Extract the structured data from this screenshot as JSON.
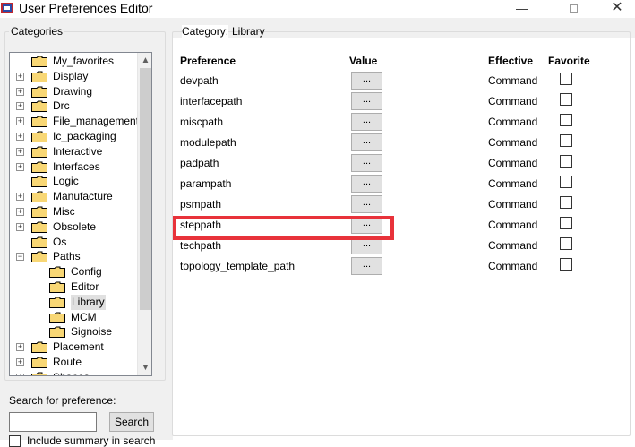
{
  "window": {
    "title": "User Preferences Editor",
    "minimize_glyph": "—",
    "close_glyph": "✕"
  },
  "categories_panel": {
    "label": "Categories",
    "tree": [
      {
        "label": "My_favorites",
        "expander": "",
        "level": 0
      },
      {
        "label": "Display",
        "expander": "+",
        "level": 0
      },
      {
        "label": "Drawing",
        "expander": "+",
        "level": 0
      },
      {
        "label": "Drc",
        "expander": "+",
        "level": 0
      },
      {
        "label": "File_management",
        "expander": "+",
        "level": 0
      },
      {
        "label": "Ic_packaging",
        "expander": "+",
        "level": 0
      },
      {
        "label": "Interactive",
        "expander": "+",
        "level": 0
      },
      {
        "label": "Interfaces",
        "expander": "+",
        "level": 0
      },
      {
        "label": "Logic",
        "expander": "",
        "level": 0
      },
      {
        "label": "Manufacture",
        "expander": "+",
        "level": 0
      },
      {
        "label": "Misc",
        "expander": "+",
        "level": 0
      },
      {
        "label": "Obsolete",
        "expander": "+",
        "level": 0
      },
      {
        "label": "Os",
        "expander": "",
        "level": 0
      },
      {
        "label": "Paths",
        "expander": "−",
        "level": 0
      },
      {
        "label": "Config",
        "expander": "",
        "level": 1
      },
      {
        "label": "Editor",
        "expander": "",
        "level": 1
      },
      {
        "label": "Library",
        "expander": "",
        "level": 1,
        "selected": true
      },
      {
        "label": "MCM",
        "expander": "",
        "level": 1
      },
      {
        "label": "Signoise",
        "expander": "",
        "level": 1
      },
      {
        "label": "Placement",
        "expander": "+",
        "level": 0
      },
      {
        "label": "Route",
        "expander": "+",
        "level": 0
      },
      {
        "label": "Shapes",
        "expander": "+",
        "level": 0
      }
    ],
    "scroll_up_glyph": "▲",
    "scroll_down_glyph": "▼",
    "search_label": "Search for preference:",
    "search_value": "",
    "search_button": "Search",
    "include_summary_label": "Include summary in search"
  },
  "category_panel": {
    "prefix": "Category:",
    "name": "Library",
    "headers": {
      "preference": "Preference",
      "value": "Value",
      "effective": "Effective",
      "favorite": "Favorite"
    },
    "rows": [
      {
        "name": "devpath",
        "button": "...",
        "effective": "Command",
        "favorite": false
      },
      {
        "name": "interfacepath",
        "button": "...",
        "effective": "Command",
        "favorite": false
      },
      {
        "name": "miscpath",
        "button": "...",
        "effective": "Command",
        "favorite": false
      },
      {
        "name": "modulepath",
        "button": "...",
        "effective": "Command",
        "favorite": false
      },
      {
        "name": "padpath",
        "button": "...",
        "effective": "Command",
        "favorite": false
      },
      {
        "name": "parampath",
        "button": "...",
        "effective": "Command",
        "favorite": false
      },
      {
        "name": "psmpath",
        "button": "...",
        "effective": "Command",
        "favorite": false
      },
      {
        "name": "steppath",
        "button": "...",
        "effective": "Command",
        "favorite": false,
        "highlighted": true
      },
      {
        "name": "techpath",
        "button": "...",
        "effective": "Command",
        "favorite": false
      },
      {
        "name": "topology_template_path",
        "button": "...",
        "effective": "Command",
        "favorite": false
      }
    ]
  },
  "colors": {
    "highlight_border": "#e8323a",
    "window_bg": "#f0f0f0",
    "panel_bg": "#ffffff",
    "folder_yellow": "#f8d775"
  }
}
